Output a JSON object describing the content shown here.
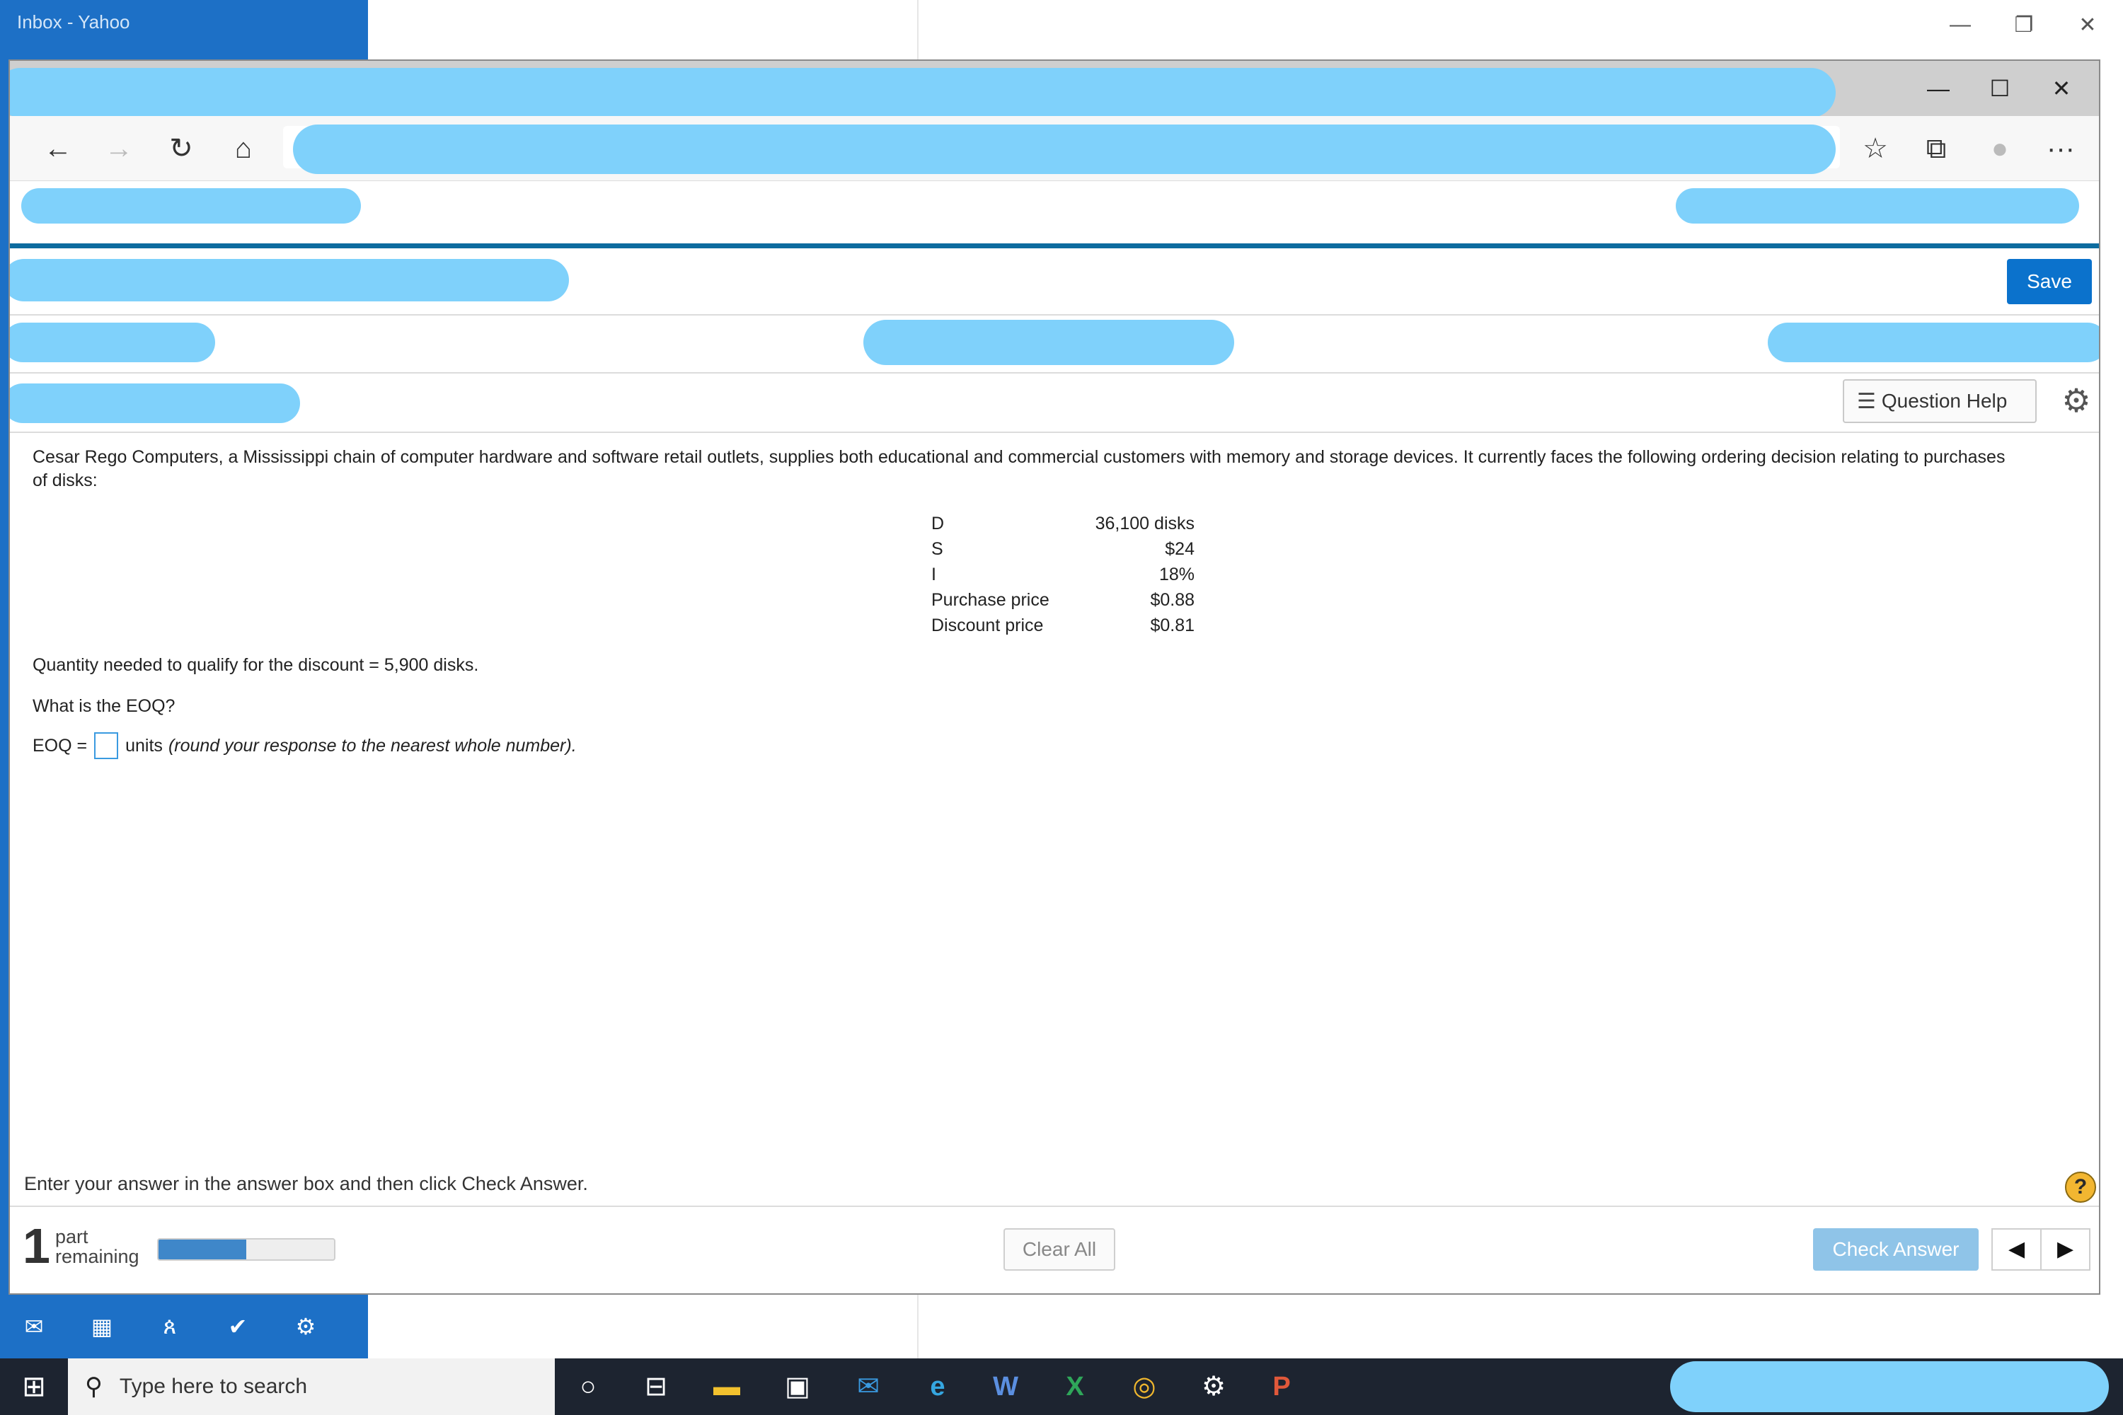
{
  "background_window": {
    "title": "Inbox - Yahoo",
    "controls": [
      "—",
      "❐",
      "✕"
    ],
    "bottom_icons": [
      "✉",
      "▦",
      "ጰ",
      "✔",
      "⚙"
    ]
  },
  "browser": {
    "window_controls": [
      "—",
      "☐",
      "✕"
    ],
    "nav": {
      "back_icon": "←",
      "forward_icon": "→",
      "refresh_icon": "↻",
      "home_icon": "⌂",
      "favorites_icon": "☆",
      "collections_icon": "⧉",
      "profile_icon": "●",
      "more_icon": "···"
    }
  },
  "toolbar": {
    "save_label": "Save",
    "question_help_label": "Question Help",
    "question_help_icon": "☰",
    "settings_icon": "⚙"
  },
  "question": {
    "intro": "Cesar Rego Computers, a Mississippi chain of computer hardware and software retail outlets, supplies both educational and commercial customers with memory and storage devices. It currently faces the following ordering decision relating to purchases of disks:",
    "table": [
      {
        "label": "D",
        "value": "36,100 disks"
      },
      {
        "label": "S",
        "value": "$24"
      },
      {
        "label": "I",
        "value": "18%"
      },
      {
        "label": "Purchase price",
        "value": "$0.88"
      },
      {
        "label": "Discount price",
        "value": "$0.81"
      }
    ],
    "qualifier": "Quantity needed to qualify for the discount = 5,900 disks.",
    "prompt": "What is the EOQ?",
    "eoq_label": "EOQ =",
    "eoq_value": "",
    "units_label": "units",
    "units_note": "(round your response to the nearest whole number)."
  },
  "footer": {
    "instruction": "Enter your answer in the answer box and then click Check Answer.",
    "help_symbol": "?",
    "parts_remaining_count": "1",
    "parts_remaining_label_1": "part",
    "parts_remaining_label_2": "remaining",
    "progress_fraction": 0.5,
    "clear_all_label": "Clear All",
    "check_answer_label": "Check Answer",
    "prev_icon": "◀",
    "next_icon": "▶"
  },
  "taskbar": {
    "start_icon": "⊞",
    "search_placeholder": "Type here to search",
    "search_icon": "⚲",
    "icons": [
      "○",
      "⊟",
      "▬",
      "▣",
      "✉",
      "e",
      "W",
      "X",
      "◎",
      "⚙",
      "P"
    ]
  },
  "colors": {
    "accent_blue": "#0b72cc",
    "page_rule": "#0d6c9f",
    "redaction": "#7fd1fb",
    "taskbar": "#1d2430",
    "mail_blue": "#1d70c6"
  }
}
